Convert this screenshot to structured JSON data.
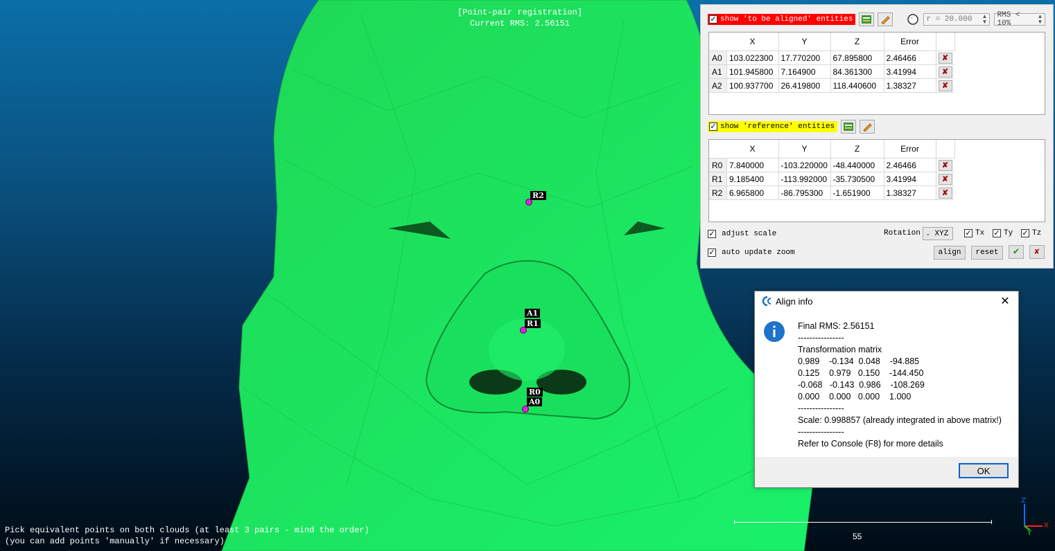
{
  "viewer": {
    "title_line1": "[Point-pair registration]",
    "title_line2": "Current RMS: 2.56151",
    "hint_line1": "Pick equivalent points on both clouds (at least 3 pairs - mind the order)",
    "hint_line2": "(you can add points 'manually' if necessary)",
    "scale_value": "55",
    "axis_z": "Z",
    "axis_x": "X",
    "axis_y": "Y",
    "points": {
      "r2": "R2",
      "a1": "A1",
      "r1": "R1",
      "r0": "R0",
      "a0": "A0"
    },
    "colors": {
      "mesh": "#1ee65a",
      "point": "#e020e0"
    }
  },
  "panel": {
    "aligned_label": "show 'to be aligned' entities",
    "aligned_color": "#ff0000",
    "reference_label": "show 'reference' entities",
    "reference_color": "#ffff00",
    "radius": "r = 20.000",
    "rms_filter": "RMS < 10%",
    "columns": [
      "X",
      "Y",
      "Z",
      "Error"
    ],
    "aligned_rows": [
      {
        "id": "A0",
        "x": "103.022300",
        "y": "17.770200",
        "z": "67.895800",
        "err": "2.46466"
      },
      {
        "id": "A1",
        "x": "101.945800",
        "y": "7.164900",
        "z": "84.361300",
        "err": "3.41994"
      },
      {
        "id": "A2",
        "x": "100.937700",
        "y": "26.419800",
        "z": "118.440600",
        "err": "1.38327"
      }
    ],
    "reference_rows": [
      {
        "id": "R0",
        "x": "7.840000",
        "y": "-103.220000",
        "z": "-48.440000",
        "err": "2.46466"
      },
      {
        "id": "R1",
        "x": "9.185400",
        "y": "-113.992000",
        "z": "-35.730500",
        "err": "3.41994"
      },
      {
        "id": "R2",
        "x": "6.965800",
        "y": "-86.795300",
        "z": "-1.651900",
        "err": "1.38327"
      }
    ],
    "adjust_scale": "adjust scale",
    "auto_update_zoom": "auto update zoom",
    "rotation_label": "Rotation",
    "rotation_value": "XYZ",
    "tx": "Tx",
    "ty": "Ty",
    "tz": "Tz",
    "align_btn": "align",
    "reset_btn": "reset"
  },
  "dialog": {
    "title": "Align info",
    "close": "✕",
    "lines": [
      "Final RMS: 2.56151",
      "----------------",
      "Transformation matrix",
      "0.989    -0.134  0.048    -94.885",
      "0.125    0.979   0.150    -144.450",
      "-0.068   -0.143  0.986    -108.269",
      "0.000    0.000   0.000    1.000",
      "----------------",
      "Scale: 0.998857 (already integrated in above matrix!)",
      "----------------",
      "Refer to Console (F8) for more details"
    ],
    "ok": "OK"
  }
}
